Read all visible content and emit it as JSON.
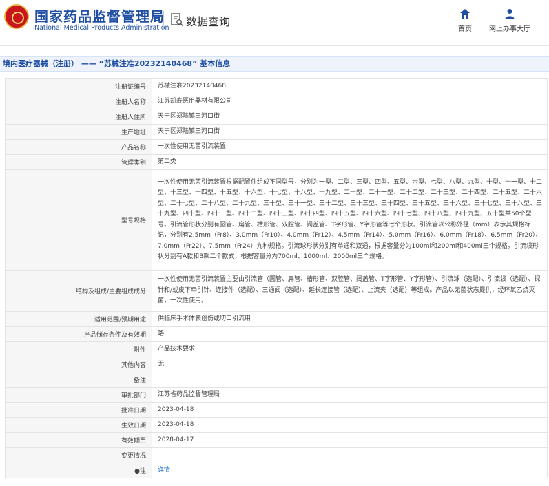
{
  "header": {
    "site_title": "国家药品监督管理局",
    "site_subtitle": "National Medical Products Administration",
    "section_label": "数据查询",
    "nav": [
      {
        "label": "首页",
        "icon": "home-icon"
      },
      {
        "label": "网上办事大厅",
        "icon": "person-icon"
      }
    ]
  },
  "colors": {
    "brand": "#1f4ea3",
    "emblem": "#c8161d",
    "link": "#1f6fd1"
  },
  "breadcrumb": "境内医疗器械（注册） —— “苏械注准20232140468” 基本信息",
  "rows": [
    {
      "label": "注册证编号",
      "value": "苏械注准20232140468"
    },
    {
      "label": "注册人名称",
      "value": "江苏凯寿医用器材有限公司"
    },
    {
      "label": "注册人住所",
      "value": "天宁区郑陆镇三河口街"
    },
    {
      "label": "生产地址",
      "value": "天宁区郑陆镇三河口街"
    },
    {
      "label": "产品名称",
      "value": "一次性使用无菌引流装置"
    },
    {
      "label": "管理类别",
      "value": "第二类"
    },
    {
      "label": "型号规格",
      "value": "一次性使用无菌引流装置根据配置件组成不同型号，分别为一型、二型、三型、四型、五型、六型、七型、八型、九型、十型、十一型、十二型、十三型、十四型、十五型、十六型、十七型、十八型、十九型、二十型、二十一型、二十二型、二十三型、二十四型、二十五型、二十六型、二十七型、二十八型、二十九型、三十型、三十一型、三十二型、三十三型、三十四型、三十五型、三十六型、三十七型、三十八型、三十九型、四十型、四十一型、四十二型、四十三型、四十四型、四十五型、四十六型、四十七型、四十八型、四十九型、五十型共50个型号。引流管形状分别有圆管、扁管、槽形管、双腔管、阀盖管、T字形管、Y字形管等七个形状。引流管以公称外径（mm）表示其规格标记，分别有2.5mm（Fr8）、3.0mm（Fr10）、4.0mm（Fr12）、4.5mm（Fr14）、5.0mm（Fr16）、6.0mm（Fr18）、6.5mm（Fr20）、7.0mm（Fr22）、7.5mm（Fr24）九种规格。引流球形状分别有单通和双通，根据容量分为100ml和200ml和400ml三个规格。引流袋形状分别有A款和B款二个款式，根据容量分为700ml、1000ml、2000ml三个规格。"
    },
    {
      "label": "结构及组成/主要组成成分",
      "value": "一次性使用无菌引流装置主要由引流管（圆管、扁管、槽形管、双腔管、阀盖管、T字形管、Y字形管）、引流球（选配）、引流袋（选配）、探针和/或皮下牵引针、连接件（选配）、三通阀（选配）、延长连接管（选配）、止流夹（选配）等组成。产品以无菌状态提供，经环氧乙烷灭菌，一次性使用。"
    },
    {
      "label": "适用范围/预期用途",
      "value": "供临床手术体表创伤或切口引流用"
    },
    {
      "label": "产品储存条件及有效期",
      "value": "略"
    },
    {
      "label": "附件",
      "value": "产品技术要求"
    },
    {
      "label": "其他内容",
      "value": "无"
    },
    {
      "label": "备注",
      "value": ""
    },
    {
      "label": "审批部门",
      "value": "江苏省药品监督管理局"
    },
    {
      "label": "批准日期",
      "value": "2023-04-18"
    },
    {
      "label": "生效日期",
      "value": "2023-04-18"
    },
    {
      "label": "有效期至",
      "value": "2028-04-17"
    },
    {
      "label": "变更情况",
      "value": ""
    },
    {
      "label": "注",
      "value": "详情"
    }
  ]
}
